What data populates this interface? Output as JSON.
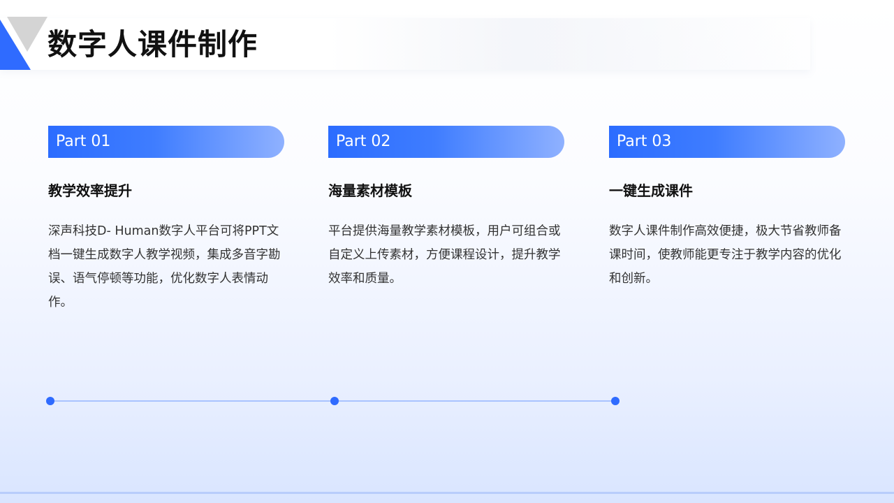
{
  "header": {
    "title": "数字人课件制作"
  },
  "columns": [
    {
      "part_label": "Part 01",
      "heading": "教学效率提升",
      "body": "深声科技D- Human数字人平台可将PPT文档一键生成数字人教学视频，集成多音字勘误、语气停顿等功能，优化数字人表情动作。"
    },
    {
      "part_label": "Part 02",
      "heading": "海量素材模板",
      "body": "平台提供海量教学素材模板，用户可组合或自定义上传素材，方便课程设计，提升教学效率和质量。"
    },
    {
      "part_label": "Part 03",
      "heading": "一键生成课件",
      "body": "数字人课件制作高效便捷，极大节省教师备课时间，使教师能更专注于教学内容的优化和创新。"
    }
  ],
  "colors": {
    "accent": "#2f6bff",
    "timeline": "#a9c3ff",
    "corner_gray": "#d4d4d4"
  }
}
